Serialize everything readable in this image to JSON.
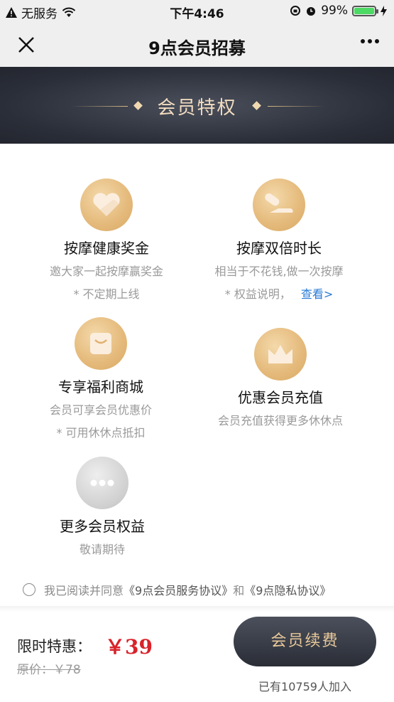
{
  "status_bar": {
    "carrier": "无服务",
    "time": "下午4:46",
    "battery": "99%",
    "battery_level": 0.99
  },
  "nav": {
    "title": "9点会员招募"
  },
  "banner": {
    "title": "会员特权"
  },
  "perks": [
    {
      "title": "按摩健康奖金",
      "desc": "邀大家一起按摩赢奖金",
      "note": "* 不定期上线",
      "icon": "heart-icon"
    },
    {
      "title": "按摩双倍时长",
      "desc": "相当于不花钱,做一次按摩",
      "note": "* 权益说明，",
      "link": "查看>",
      "icon": "massage-icon"
    },
    {
      "title": "专享福利商城",
      "desc": "会员可享会员优惠价",
      "note": "* 可用休休点抵扣",
      "icon": "shopping-bag-icon"
    },
    {
      "title": "优惠会员充值",
      "desc": "会员充值获得更多休休点",
      "icon": "crown-icon"
    },
    {
      "title": "更多会员权益",
      "desc": "敬请期待",
      "icon": "more-icon"
    }
  ],
  "agreement": {
    "prefix": "我已阅读并同意",
    "service_link": "《9点会员服务协议》",
    "and": "和",
    "privacy_link": "《9点隐私协议》"
  },
  "footer": {
    "price_label": "限时特惠：",
    "price": "￥39",
    "original_price": "原价：￥78",
    "button_label": "会员续费",
    "joined_text": "已有10759人加入"
  },
  "colors": {
    "accent_gold": "#e4b97a",
    "price_red": "#d9222a",
    "link_blue": "#2b7bd6",
    "banner_dark": "#2a2e38"
  }
}
